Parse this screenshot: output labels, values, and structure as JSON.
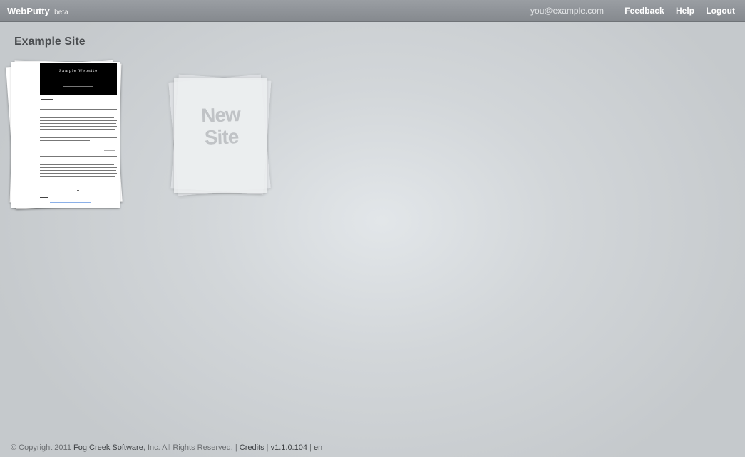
{
  "header": {
    "brand": "WebPutty",
    "brand_tag": "beta",
    "user_email": "you@example.com",
    "links": {
      "feedback": "Feedback",
      "help": "Help",
      "logout": "Logout"
    }
  },
  "main": {
    "page_title": "Example Site",
    "site_thumbnail": {
      "title": "Sample Website"
    },
    "new_site": {
      "line1": "New",
      "line2": "Site"
    }
  },
  "footer": {
    "copyright_prefix": "© Copyright 2011",
    "company_link": "Fog Creek Software",
    "rights": ", Inc. All Rights Reserved. |",
    "credits_link": "Credits",
    "sep1": "|",
    "version_link": "v1.1.0.104",
    "sep2": "|",
    "lang_link": "en"
  }
}
